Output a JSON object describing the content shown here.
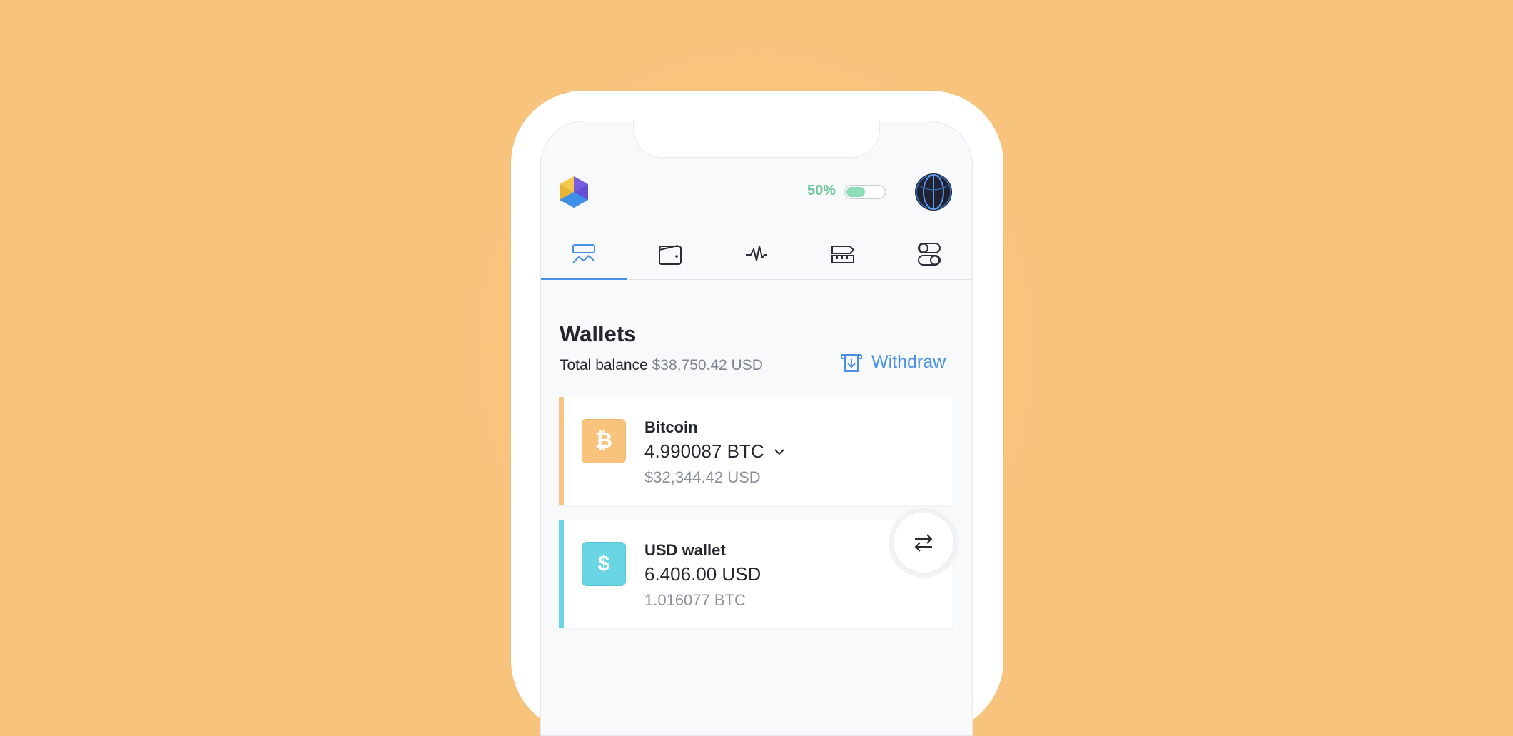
{
  "colors": {
    "background": "#F8C37D",
    "accent": "#4A90E2",
    "battery": "#8DDCB5",
    "bitcoin": "#F8C37D",
    "usd": "#6AD6E4"
  },
  "header": {
    "battery_label": "50%",
    "battery_level": 0.5
  },
  "tabs": [
    {
      "icon": "dashboard-chart-icon",
      "active": true
    },
    {
      "icon": "wallet-icon",
      "active": false
    },
    {
      "icon": "activity-pulse-icon",
      "active": false
    },
    {
      "icon": "ruler-tools-icon",
      "active": false
    },
    {
      "icon": "toggle-settings-icon",
      "active": false
    }
  ],
  "main": {
    "title": "Wallets",
    "balance_label": "Total balance",
    "balance_value": "$38,750.42 USD",
    "withdraw_label": "Withdraw"
  },
  "wallets": [
    {
      "name": "Bitcoin",
      "symbol": "₿",
      "amount": "4.990087 BTC",
      "converted": "$32,344.42 USD",
      "icon": "bitcoin-icon"
    },
    {
      "name": "USD wallet",
      "symbol": "$",
      "amount": "6.406.00 USD",
      "converted": "1.016077 BTC",
      "icon": "dollar-icon"
    }
  ]
}
